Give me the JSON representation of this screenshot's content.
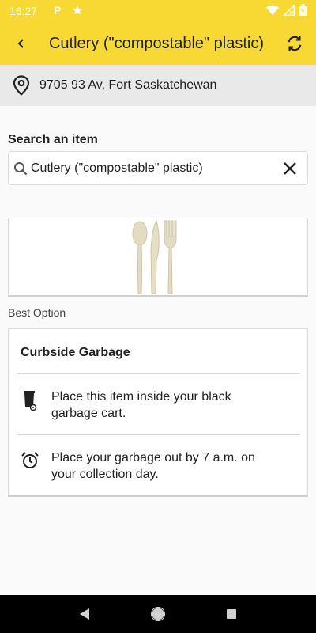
{
  "status_bar": {
    "time": "16:27"
  },
  "app_bar": {
    "title": "Cutlery (\"compostable\" plastic)"
  },
  "address": {
    "text": "9705 93 Av, Fort Saskatchewan"
  },
  "search": {
    "label": "Search an item",
    "value": "Cutlery (\"compostable\" plastic)"
  },
  "best_option_label": "Best Option",
  "option": {
    "title": "Curbside Garbage",
    "rows": [
      {
        "icon": "garbage-cart-icon",
        "text": "Place this item inside your black garbage cart."
      },
      {
        "icon": "alarm-clock-icon",
        "text": "Place your garbage out by 7 a.m. on your collection day."
      }
    ]
  },
  "colors": {
    "accent": "#f8d933",
    "address_bg": "#e9e9e9",
    "nav_bg": "#000000"
  }
}
